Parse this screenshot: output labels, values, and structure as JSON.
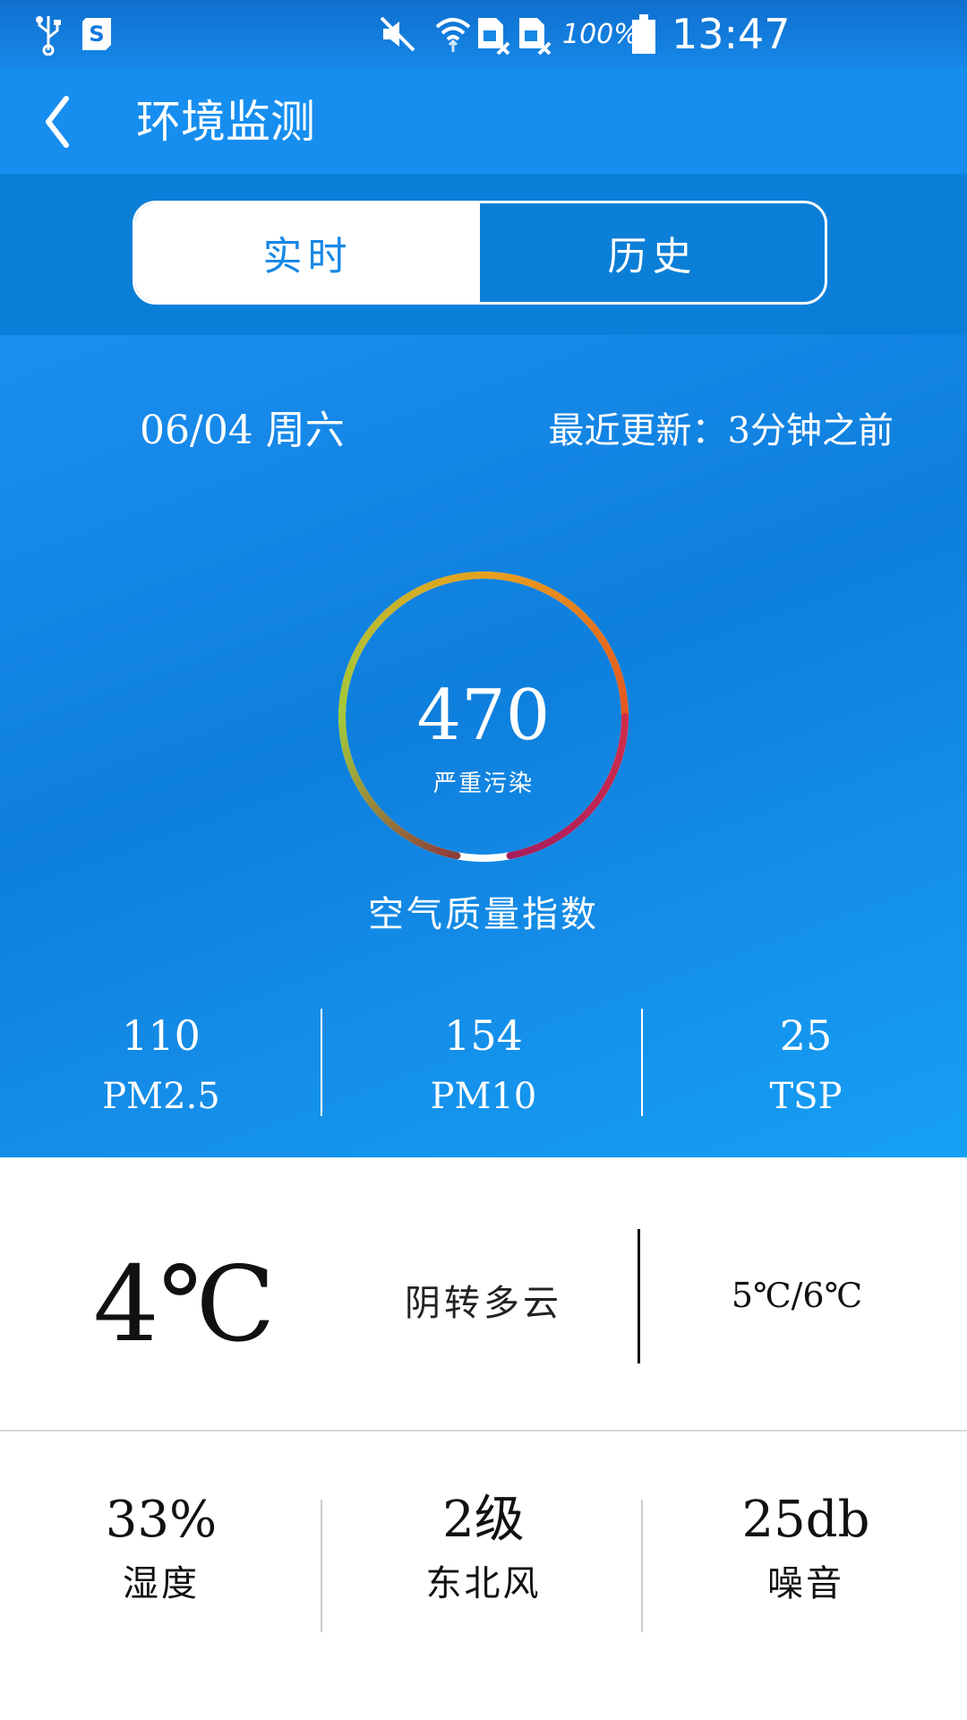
{
  "status_bar": {
    "battery_percent": "100%",
    "time": "13:47",
    "icons": [
      "usb-icon",
      "s-app-icon",
      "mute-icon",
      "wifi-icon",
      "no-sim-icon",
      "no-sim-icon",
      "battery-icon"
    ]
  },
  "app_bar": {
    "title": "环境监测",
    "back_icon": "chevron-left-icon"
  },
  "tabs": [
    {
      "label": "实时",
      "active": true
    },
    {
      "label": "历史",
      "active": false
    }
  ],
  "air_quality": {
    "date": "06/04 周六",
    "last_update": "最近更新：3分钟之前",
    "aqi": "470",
    "level": "严重污染",
    "caption": "空气质量指数",
    "gauge_fill": 0.94,
    "pollutants": [
      {
        "value": "110",
        "label": "PM2.5"
      },
      {
        "value": "154",
        "label": "PM10"
      },
      {
        "value": "25",
        "label": "TSP"
      }
    ]
  },
  "weather": {
    "temperature": "4℃",
    "condition": "阴转多云",
    "range": "5℃/6℃"
  },
  "environment": [
    {
      "value": "33%",
      "label": "湿度"
    },
    {
      "value": "2级",
      "label": "东北风"
    },
    {
      "value": "25db",
      "label": "噪音"
    }
  ],
  "colors": {
    "primary": "#168EF0",
    "gauge_colors": [
      "#A3C93A",
      "#E6A11E",
      "#E4571E",
      "#B51E5A",
      "#8C3A3A"
    ]
  }
}
